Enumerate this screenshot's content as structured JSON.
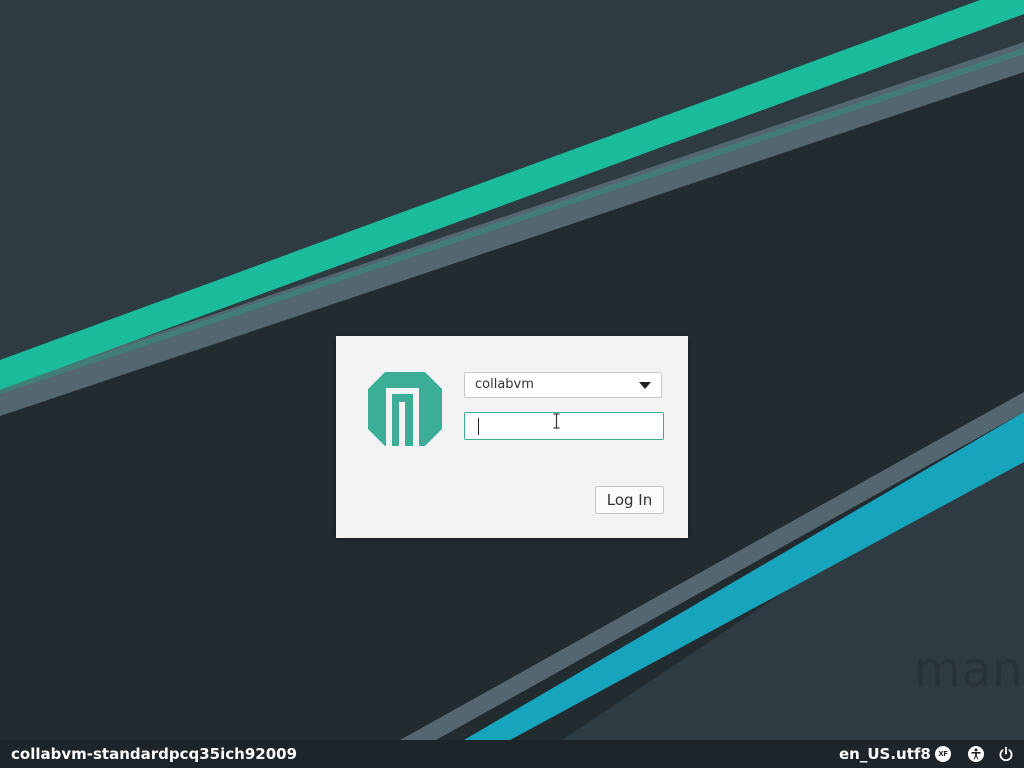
{
  "wallpaper": {
    "background_color": "#222b30",
    "upper_panel_color": "#2f3b42",
    "teal_stripe_color": "#1bbc9b",
    "gray_stripe_color": "#546770",
    "cyan_stripe_color": "#17a4bd",
    "watermark_text": "man"
  },
  "login": {
    "username": "collabvm",
    "password_value": "",
    "login_button_label": "Log In",
    "accent_color": "#3cad97",
    "logo_color": "#3cad97"
  },
  "panel": {
    "hostname": "collabvm-standardpcq35ich92009",
    "locale": "en_US.utf8",
    "keyboard_layout_label": "XF",
    "icons": [
      "keyboard-layout-icon",
      "accessibility-icon",
      "power-icon"
    ]
  }
}
